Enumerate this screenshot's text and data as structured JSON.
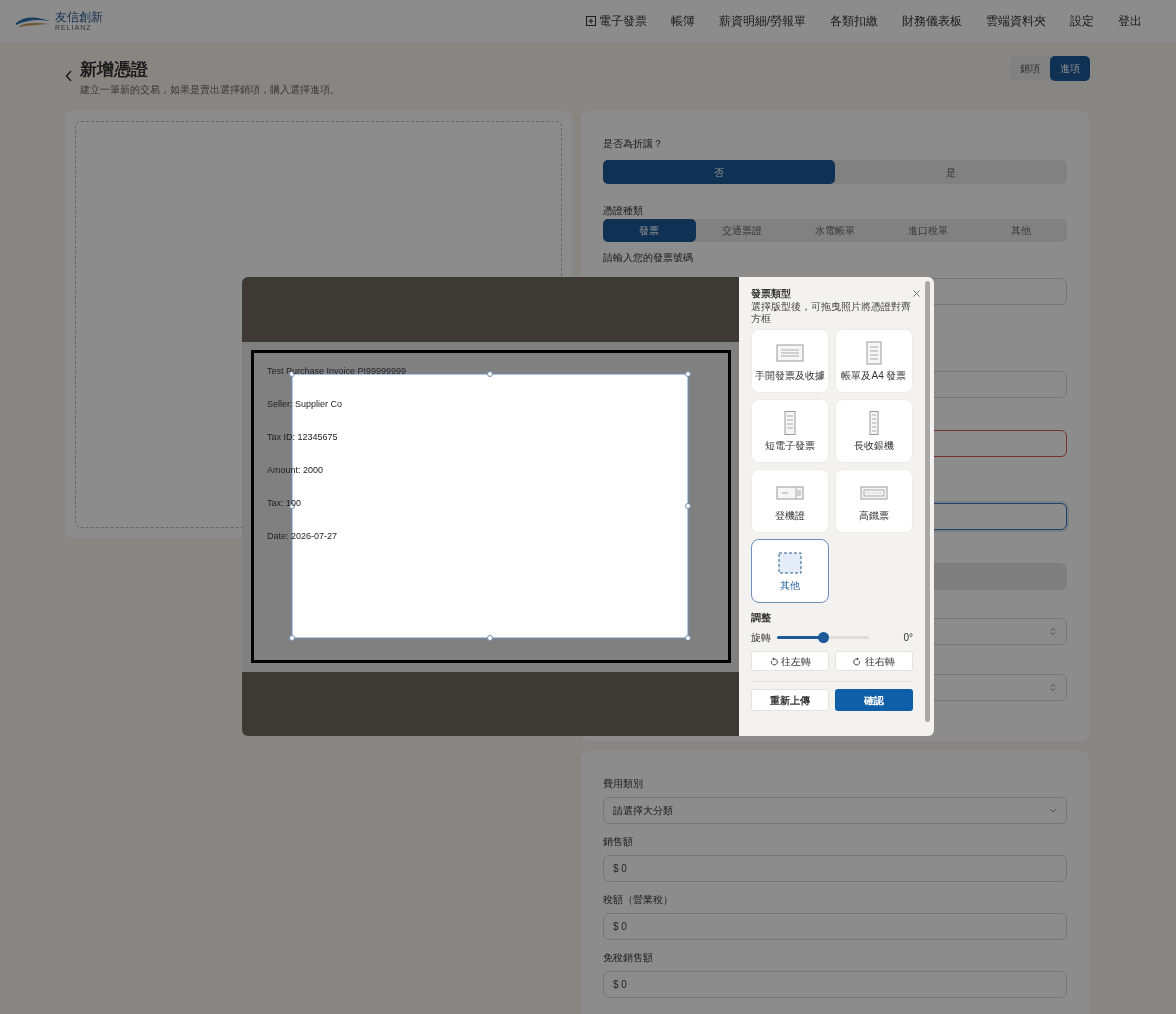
{
  "nav": {
    "brand": "友信創新",
    "brand_sub": "RELIANZ",
    "items": [
      {
        "label": "電子發票",
        "has_icon": true
      },
      {
        "label": "帳簿",
        "has_icon": false
      },
      {
        "label": "薪資明細/勞報單",
        "has_icon": false
      },
      {
        "label": "各類扣繳",
        "has_icon": false
      },
      {
        "label": "財務儀表板",
        "has_icon": false
      },
      {
        "label": "雲端資料夾",
        "has_icon": false
      },
      {
        "label": "設定",
        "has_icon": false
      },
      {
        "label": "登出",
        "has_icon": false
      }
    ]
  },
  "header": {
    "title": "新增憑證",
    "subtitle": "建立一筆新的交易，如果是賣出選擇銷項，購入選擇進項。",
    "modes": [
      {
        "label": "銷項",
        "selected": false
      },
      {
        "label": "進項",
        "selected": true
      }
    ]
  },
  "form": {
    "discount": {
      "label": "是否為折讓？",
      "options": [
        {
          "label": "否",
          "selected": true
        },
        {
          "label": "是",
          "selected": false
        }
      ]
    },
    "voucher_type": {
      "label": "憑證種類",
      "options": [
        {
          "label": "發票",
          "selected": true
        },
        {
          "label": "交通票證",
          "selected": false
        },
        {
          "label": "水電帳單",
          "selected": false
        },
        {
          "label": "進口稅單",
          "selected": false
        },
        {
          "label": "其他",
          "selected": false
        }
      ]
    },
    "invoice_number_label": "請輸入您的發票號碼",
    "hidden_fields": [
      {
        "kind": "input",
        "error": false,
        "focused": false
      },
      {
        "kind": "input",
        "error": false,
        "focused": false
      },
      {
        "kind": "input",
        "error": true,
        "focused": false
      },
      {
        "kind": "input",
        "error": false,
        "focused": true
      },
      {
        "kind": "bar"
      },
      {
        "kind": "select",
        "error": false,
        "focused": false
      },
      {
        "kind": "select",
        "error": false,
        "focused": false
      }
    ]
  },
  "expense": {
    "fields": [
      {
        "kind": "select",
        "label": "費用類別",
        "value": "請選擇大分類"
      },
      {
        "kind": "money",
        "label": "銷售額",
        "value": "$ 0"
      },
      {
        "kind": "money",
        "label": "稅額（營業稅）",
        "value": "$ 0"
      },
      {
        "kind": "money",
        "label": "免稅銷售額",
        "value": "$ 0"
      }
    ]
  },
  "modal": {
    "document": {
      "lines": [
        "Test Purchase Invoice PI99999999",
        "Seller: Supplier Co",
        "Tax ID: 12345675",
        "Amount: 2000",
        "Tax: 100",
        "Date: 2026-07-27"
      ]
    },
    "panel": {
      "title": "發票類型",
      "subtitle": "選擇版型後，可拖曳照片將憑證對齊方框",
      "templates": [
        {
          "label": "手開發票及收據",
          "kind": "wide",
          "selected": false
        },
        {
          "label": "帳單及A4 發票",
          "kind": "a4",
          "selected": false
        },
        {
          "label": "短電子發票",
          "kind": "short",
          "selected": false
        },
        {
          "label": "長收銀機",
          "kind": "long",
          "selected": false
        },
        {
          "label": "登機證",
          "kind": "boarding",
          "selected": false
        },
        {
          "label": "高鐵票",
          "kind": "rail",
          "selected": false
        },
        {
          "label": "其他",
          "kind": "custom",
          "selected": true
        }
      ],
      "adjust_title": "調整",
      "rotation": {
        "label": "旋轉",
        "level": 0.5,
        "reading": "0°"
      },
      "rotate_buttons": [
        {
          "label": "往左轉",
          "kind": "left"
        },
        {
          "label": "往右轉",
          "kind": "right"
        }
      ],
      "actions": [
        {
          "label": "重新上傳",
          "kind": "secondary"
        },
        {
          "label": "確認",
          "kind": "primary"
        }
      ]
    }
  }
}
